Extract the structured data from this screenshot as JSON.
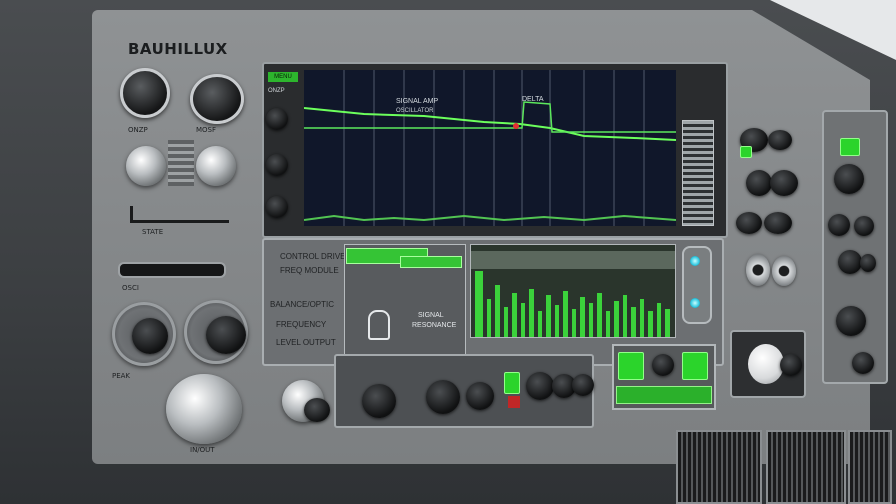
{
  "brand": "BAUHILLUX",
  "left_panel": {
    "labels": [
      "ONZP",
      "MOSF",
      "STATE",
      "OSCI",
      "PEAK",
      "IN/OUT"
    ]
  },
  "scope": {
    "badge": "MENU",
    "title": "SIGNAL AMP",
    "subtitle": "OSCILLATOR",
    "right_title": "DELTA"
  },
  "mid_labels": {
    "left_top": "CONTROL DRIVE",
    "left_mid": "FREQ MODULE",
    "row1": "BALANCE/OPTIC",
    "row2": "FREQUENCY",
    "row3": "LEVEL OUTPUT",
    "tag1": "SIGNAL",
    "tag2": "RESONANCE"
  },
  "colors": {
    "accent_green": "#35c435",
    "panel_gray": "#85888a",
    "frame_dark": "#3b3e41",
    "screen_dark": "#11182a"
  }
}
